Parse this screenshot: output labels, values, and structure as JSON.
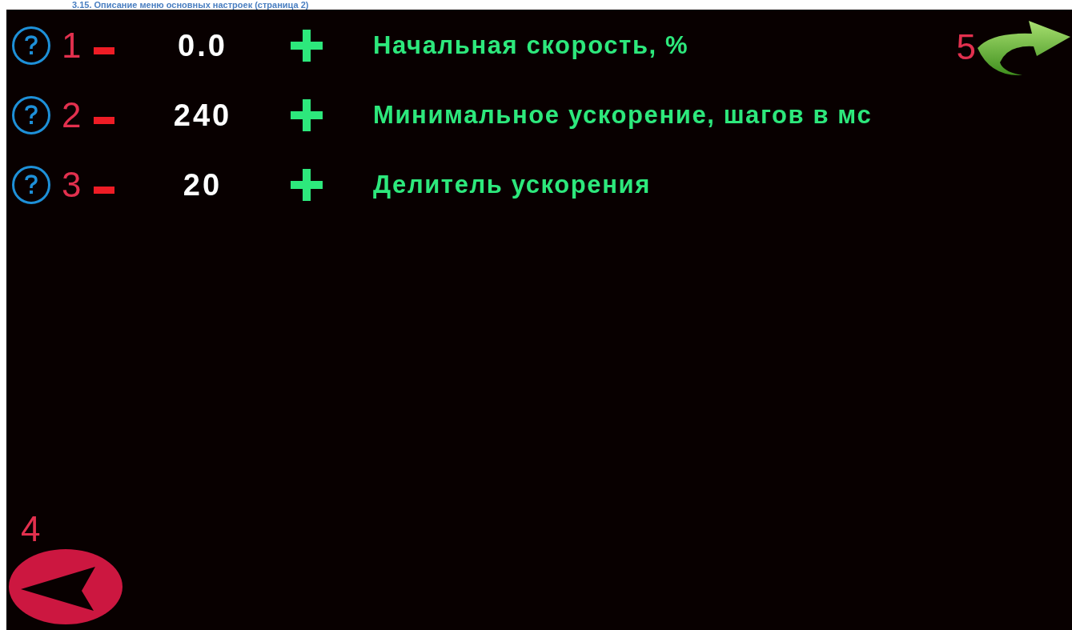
{
  "heading": "3.15. Описание меню основных настроек (страница 2)",
  "rows": [
    {
      "marker": "1",
      "value": "0.0",
      "label": "Начальная скорость, %"
    },
    {
      "marker": "2",
      "value": "240",
      "label": "Минимальное ускорение, шагов в мс"
    },
    {
      "marker": "3",
      "value": "20",
      "label": "Делитель ускорения"
    }
  ],
  "next_marker": "5",
  "back_marker": "4"
}
